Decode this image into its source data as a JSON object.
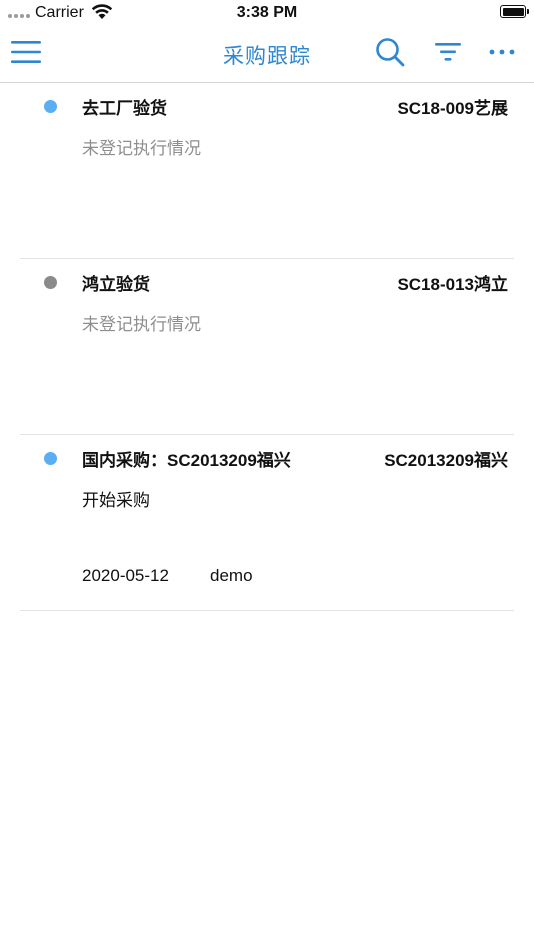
{
  "status_bar": {
    "carrier": "Carrier",
    "time": "3:38 PM"
  },
  "nav": {
    "title": "采购跟踪",
    "icons": [
      "menu-icon",
      "search-icon",
      "filter-icon",
      "more-icon"
    ]
  },
  "colors": {
    "accent": "#2e87d0",
    "dot_active": "#5aaef2",
    "dot_inactive": "#8a8a8a",
    "muted_text": "#8e8e8e"
  },
  "items": [
    {
      "title": "去工厂验货",
      "code": "SC18-009艺展",
      "status": "未登记执行情况",
      "date": "",
      "user": "",
      "dot": "active"
    },
    {
      "title": "鸿立验货",
      "code": "SC18-013鸿立",
      "status": "未登记执行情况",
      "date": "",
      "user": "",
      "dot": "inactive"
    },
    {
      "title": "国内采购：SC2013209福兴",
      "code": "SC2013209福兴",
      "status": "开始采购",
      "date": "2020-05-12",
      "user": "demo",
      "dot": "active"
    }
  ]
}
